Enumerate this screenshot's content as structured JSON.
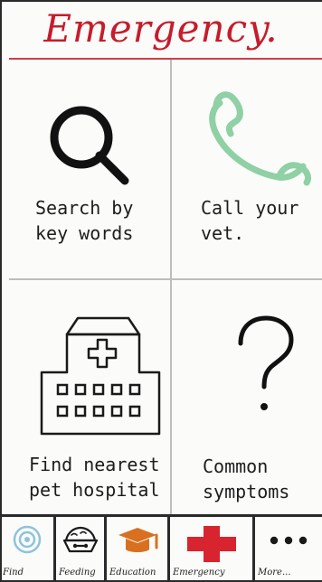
{
  "header": {
    "title": "Emergency."
  },
  "tiles": [
    {
      "name": "search-tile",
      "label": "Search by\nkey words",
      "icon": "search-icon"
    },
    {
      "name": "call-vet-tile",
      "label": "Call your\nvet.",
      "icon": "phone-icon"
    },
    {
      "name": "hospital-tile",
      "label": "Find nearest\npet hospital",
      "icon": "hospital-icon"
    },
    {
      "name": "symptoms-tile",
      "label": "Common\nsymptoms",
      "icon": "question-icon"
    }
  ],
  "nav": {
    "items": [
      {
        "key": "find",
        "label": "Find",
        "icon": "location-target-icon"
      },
      {
        "key": "feeding",
        "label": "Feeding",
        "icon": "pet-bowl-icon"
      },
      {
        "key": "education",
        "label": "Education",
        "icon": "graduation-cap-icon"
      },
      {
        "key": "emergency",
        "label": "Emergency",
        "icon": "red-cross-icon"
      },
      {
        "key": "more",
        "label": "More...",
        "icon": "dots-icon"
      }
    ],
    "colors": {
      "find": "#8ec3dc",
      "education": "#d87020",
      "emergency": "#d7242f"
    }
  },
  "colors": {
    "title_red": "#c61c2b",
    "phone_green": "#8fd0a5"
  }
}
